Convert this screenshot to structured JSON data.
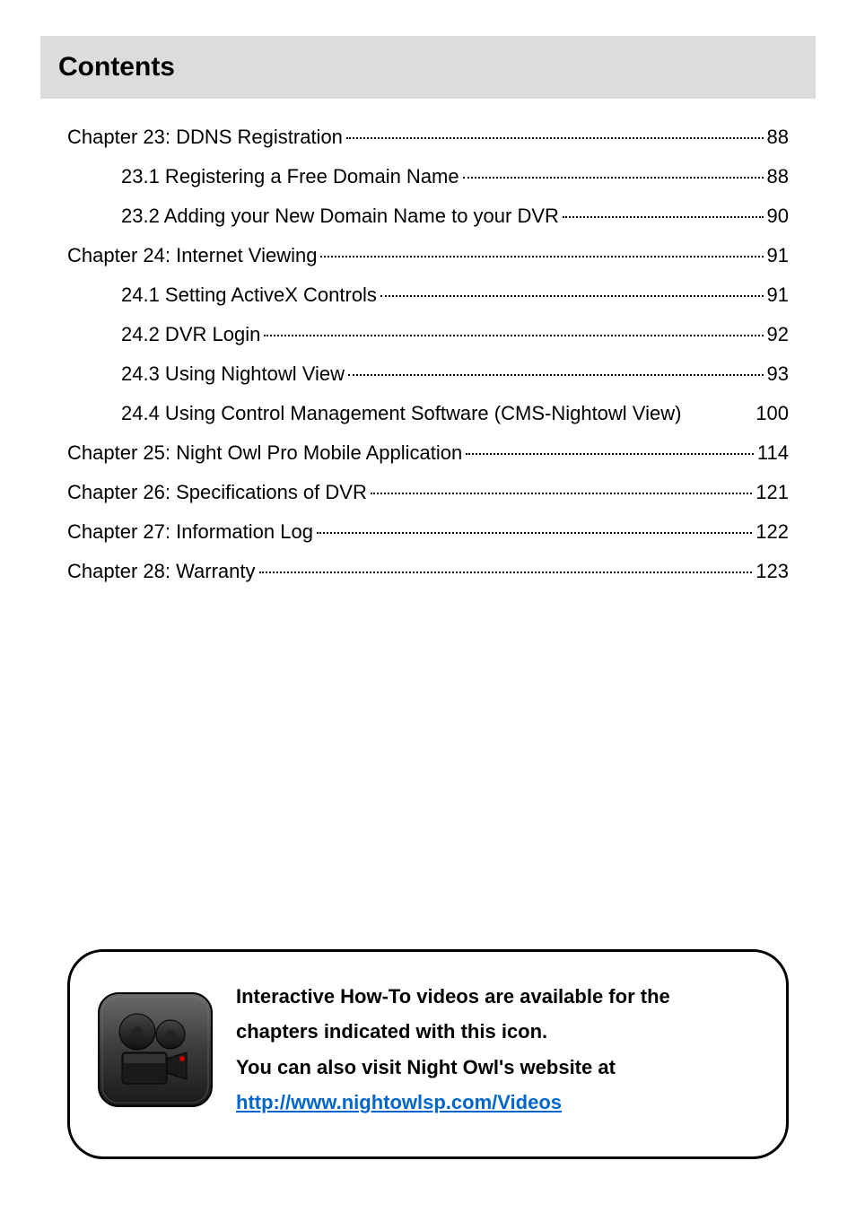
{
  "header": {
    "title": "Contents"
  },
  "toc": [
    {
      "label": "Chapter 23: DDNS Registration",
      "page": "88",
      "indent": false,
      "dots": true
    },
    {
      "label": "23.1 Registering a Free Domain Name",
      "page": "88",
      "indent": true,
      "dots": true
    },
    {
      "label": "23.2 Adding your New Domain Name to your DVR",
      "page": "90",
      "indent": true,
      "dots": true
    },
    {
      "label": "Chapter 24: Internet Viewing",
      "page": "91",
      "indent": false,
      "dots": true
    },
    {
      "label": "24.1 Setting ActiveX Controls",
      "page": "91",
      "indent": true,
      "dots": true
    },
    {
      "label": "24.2 DVR Login",
      "page": "92",
      "indent": true,
      "dots": true
    },
    {
      "label": "24.3 Using Nightowl View",
      "page": "93",
      "indent": true,
      "dots": true
    },
    {
      "label": "24.4 Using Control Management Software (CMS-Nightowl View)",
      "page": "100",
      "indent": true,
      "dots": false
    },
    {
      "label": "Chapter 25: Night Owl Pro Mobile Application",
      "page": "114",
      "indent": false,
      "dots": true
    },
    {
      "label": "Chapter 26: Specifications of DVR",
      "page": "121",
      "indent": false,
      "dots": true
    },
    {
      "label": "Chapter 27: Information Log",
      "page": "122",
      "indent": false,
      "dots": true
    },
    {
      "label": "Chapter 28: Warranty",
      "page": "123",
      "indent": false,
      "dots": true
    }
  ],
  "callout": {
    "line1": "Interactive How-To videos are available for the",
    "line2": "chapters indicated with this icon.",
    "line3": "You can also visit Night Owl's website at",
    "link": "http://www.nightowlsp.com/Videos"
  }
}
